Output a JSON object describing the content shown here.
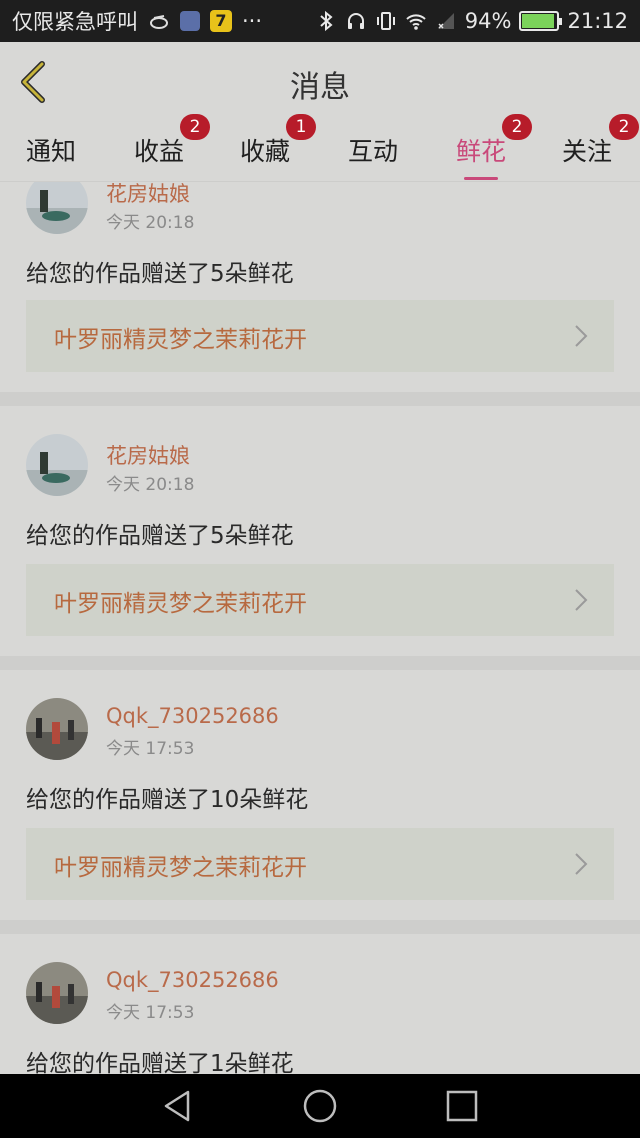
{
  "status_bar": {
    "carrier_text": "仅限紧急呼叫",
    "more": "···",
    "app2_label": "7",
    "battery_percent": "94%",
    "battery_level": 0.94,
    "time": "21:12"
  },
  "header": {
    "title": "消息"
  },
  "tabs": [
    {
      "label": "通知",
      "badge": ""
    },
    {
      "label": "收益",
      "badge": "2"
    },
    {
      "label": "收藏",
      "badge": "1"
    },
    {
      "label": "互动",
      "badge": ""
    },
    {
      "label": "鲜花",
      "badge": "2",
      "active": true
    },
    {
      "label": "关注",
      "badge": "2"
    }
  ],
  "feed": {
    "items": [
      {
        "username": "花房姑娘",
        "time": "今天 20:18",
        "message": "给您的作品赠送了5朵鲜花",
        "work_title": "叶罗丽精灵梦之茉莉花开"
      },
      {
        "username": "花房姑娘",
        "time": "今天 20:18",
        "message": "给您的作品赠送了5朵鲜花",
        "work_title": "叶罗丽精灵梦之茉莉花开"
      },
      {
        "username": "Qqk_730252686",
        "time": "今天 17:53",
        "message": "给您的作品赠送了10朵鲜花",
        "work_title": "叶罗丽精灵梦之茉莉花开"
      },
      {
        "username": "Qqk_730252686",
        "time": "今天 17:53",
        "message": "给您的作品赠送了1朵鲜花",
        "work_title": ""
      }
    ]
  },
  "colors": {
    "accent": "#c9497a",
    "badge": "#b71c2a",
    "username": "#b96a4a",
    "work_title": "#b7693f",
    "background": "#d8d8d6"
  }
}
